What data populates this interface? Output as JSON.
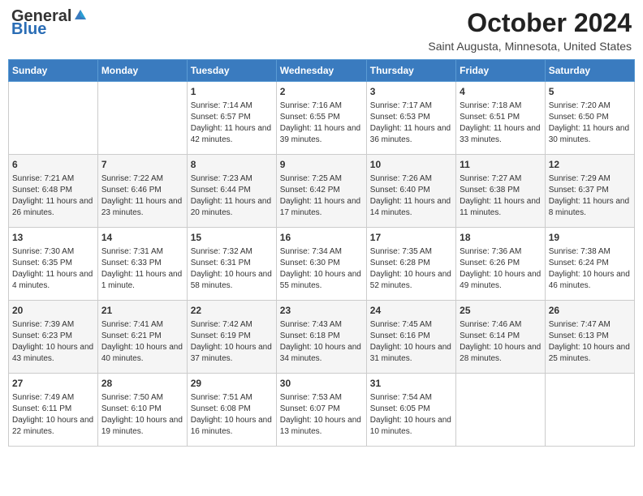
{
  "header": {
    "logo_general": "General",
    "logo_blue": "Blue",
    "month": "October 2024",
    "location": "Saint Augusta, Minnesota, United States"
  },
  "days_of_week": [
    "Sunday",
    "Monday",
    "Tuesday",
    "Wednesday",
    "Thursday",
    "Friday",
    "Saturday"
  ],
  "weeks": [
    [
      {
        "day": "",
        "sunrise": "",
        "sunset": "",
        "daylight": ""
      },
      {
        "day": "",
        "sunrise": "",
        "sunset": "",
        "daylight": ""
      },
      {
        "day": "1",
        "sunrise": "Sunrise: 7:14 AM",
        "sunset": "Sunset: 6:57 PM",
        "daylight": "Daylight: 11 hours and 42 minutes."
      },
      {
        "day": "2",
        "sunrise": "Sunrise: 7:16 AM",
        "sunset": "Sunset: 6:55 PM",
        "daylight": "Daylight: 11 hours and 39 minutes."
      },
      {
        "day": "3",
        "sunrise": "Sunrise: 7:17 AM",
        "sunset": "Sunset: 6:53 PM",
        "daylight": "Daylight: 11 hours and 36 minutes."
      },
      {
        "day": "4",
        "sunrise": "Sunrise: 7:18 AM",
        "sunset": "Sunset: 6:51 PM",
        "daylight": "Daylight: 11 hours and 33 minutes."
      },
      {
        "day": "5",
        "sunrise": "Sunrise: 7:20 AM",
        "sunset": "Sunset: 6:50 PM",
        "daylight": "Daylight: 11 hours and 30 minutes."
      }
    ],
    [
      {
        "day": "6",
        "sunrise": "Sunrise: 7:21 AM",
        "sunset": "Sunset: 6:48 PM",
        "daylight": "Daylight: 11 hours and 26 minutes."
      },
      {
        "day": "7",
        "sunrise": "Sunrise: 7:22 AM",
        "sunset": "Sunset: 6:46 PM",
        "daylight": "Daylight: 11 hours and 23 minutes."
      },
      {
        "day": "8",
        "sunrise": "Sunrise: 7:23 AM",
        "sunset": "Sunset: 6:44 PM",
        "daylight": "Daylight: 11 hours and 20 minutes."
      },
      {
        "day": "9",
        "sunrise": "Sunrise: 7:25 AM",
        "sunset": "Sunset: 6:42 PM",
        "daylight": "Daylight: 11 hours and 17 minutes."
      },
      {
        "day": "10",
        "sunrise": "Sunrise: 7:26 AM",
        "sunset": "Sunset: 6:40 PM",
        "daylight": "Daylight: 11 hours and 14 minutes."
      },
      {
        "day": "11",
        "sunrise": "Sunrise: 7:27 AM",
        "sunset": "Sunset: 6:38 PM",
        "daylight": "Daylight: 11 hours and 11 minutes."
      },
      {
        "day": "12",
        "sunrise": "Sunrise: 7:29 AM",
        "sunset": "Sunset: 6:37 PM",
        "daylight": "Daylight: 11 hours and 8 minutes."
      }
    ],
    [
      {
        "day": "13",
        "sunrise": "Sunrise: 7:30 AM",
        "sunset": "Sunset: 6:35 PM",
        "daylight": "Daylight: 11 hours and 4 minutes."
      },
      {
        "day": "14",
        "sunrise": "Sunrise: 7:31 AM",
        "sunset": "Sunset: 6:33 PM",
        "daylight": "Daylight: 11 hours and 1 minute."
      },
      {
        "day": "15",
        "sunrise": "Sunrise: 7:32 AM",
        "sunset": "Sunset: 6:31 PM",
        "daylight": "Daylight: 10 hours and 58 minutes."
      },
      {
        "day": "16",
        "sunrise": "Sunrise: 7:34 AM",
        "sunset": "Sunset: 6:30 PM",
        "daylight": "Daylight: 10 hours and 55 minutes."
      },
      {
        "day": "17",
        "sunrise": "Sunrise: 7:35 AM",
        "sunset": "Sunset: 6:28 PM",
        "daylight": "Daylight: 10 hours and 52 minutes."
      },
      {
        "day": "18",
        "sunrise": "Sunrise: 7:36 AM",
        "sunset": "Sunset: 6:26 PM",
        "daylight": "Daylight: 10 hours and 49 minutes."
      },
      {
        "day": "19",
        "sunrise": "Sunrise: 7:38 AM",
        "sunset": "Sunset: 6:24 PM",
        "daylight": "Daylight: 10 hours and 46 minutes."
      }
    ],
    [
      {
        "day": "20",
        "sunrise": "Sunrise: 7:39 AM",
        "sunset": "Sunset: 6:23 PM",
        "daylight": "Daylight: 10 hours and 43 minutes."
      },
      {
        "day": "21",
        "sunrise": "Sunrise: 7:41 AM",
        "sunset": "Sunset: 6:21 PM",
        "daylight": "Daylight: 10 hours and 40 minutes."
      },
      {
        "day": "22",
        "sunrise": "Sunrise: 7:42 AM",
        "sunset": "Sunset: 6:19 PM",
        "daylight": "Daylight: 10 hours and 37 minutes."
      },
      {
        "day": "23",
        "sunrise": "Sunrise: 7:43 AM",
        "sunset": "Sunset: 6:18 PM",
        "daylight": "Daylight: 10 hours and 34 minutes."
      },
      {
        "day": "24",
        "sunrise": "Sunrise: 7:45 AM",
        "sunset": "Sunset: 6:16 PM",
        "daylight": "Daylight: 10 hours and 31 minutes."
      },
      {
        "day": "25",
        "sunrise": "Sunrise: 7:46 AM",
        "sunset": "Sunset: 6:14 PM",
        "daylight": "Daylight: 10 hours and 28 minutes."
      },
      {
        "day": "26",
        "sunrise": "Sunrise: 7:47 AM",
        "sunset": "Sunset: 6:13 PM",
        "daylight": "Daylight: 10 hours and 25 minutes."
      }
    ],
    [
      {
        "day": "27",
        "sunrise": "Sunrise: 7:49 AM",
        "sunset": "Sunset: 6:11 PM",
        "daylight": "Daylight: 10 hours and 22 minutes."
      },
      {
        "day": "28",
        "sunrise": "Sunrise: 7:50 AM",
        "sunset": "Sunset: 6:10 PM",
        "daylight": "Daylight: 10 hours and 19 minutes."
      },
      {
        "day": "29",
        "sunrise": "Sunrise: 7:51 AM",
        "sunset": "Sunset: 6:08 PM",
        "daylight": "Daylight: 10 hours and 16 minutes."
      },
      {
        "day": "30",
        "sunrise": "Sunrise: 7:53 AM",
        "sunset": "Sunset: 6:07 PM",
        "daylight": "Daylight: 10 hours and 13 minutes."
      },
      {
        "day": "31",
        "sunrise": "Sunrise: 7:54 AM",
        "sunset": "Sunset: 6:05 PM",
        "daylight": "Daylight: 10 hours and 10 minutes."
      },
      {
        "day": "",
        "sunrise": "",
        "sunset": "",
        "daylight": ""
      },
      {
        "day": "",
        "sunrise": "",
        "sunset": "",
        "daylight": ""
      }
    ]
  ]
}
